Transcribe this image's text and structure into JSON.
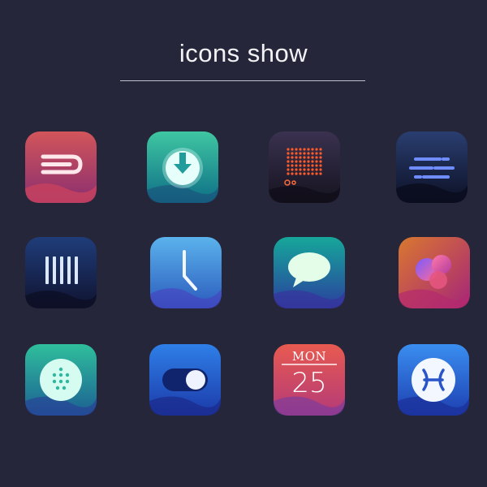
{
  "header": {
    "title": "icons show"
  },
  "icons": [
    {
      "name": "exit-icon"
    },
    {
      "name": "download-icon"
    },
    {
      "name": "led-display-icon"
    },
    {
      "name": "menu-lines-icon"
    },
    {
      "name": "equalizer-bars-icon"
    },
    {
      "name": "clock-icon"
    },
    {
      "name": "message-bubble-icon"
    },
    {
      "name": "color-circles-icon"
    },
    {
      "name": "dialpad-icon"
    },
    {
      "name": "toggle-switch-icon"
    },
    {
      "name": "calendar-icon",
      "month": "MON",
      "day": "25"
    },
    {
      "name": "pisces-icon"
    }
  ]
}
